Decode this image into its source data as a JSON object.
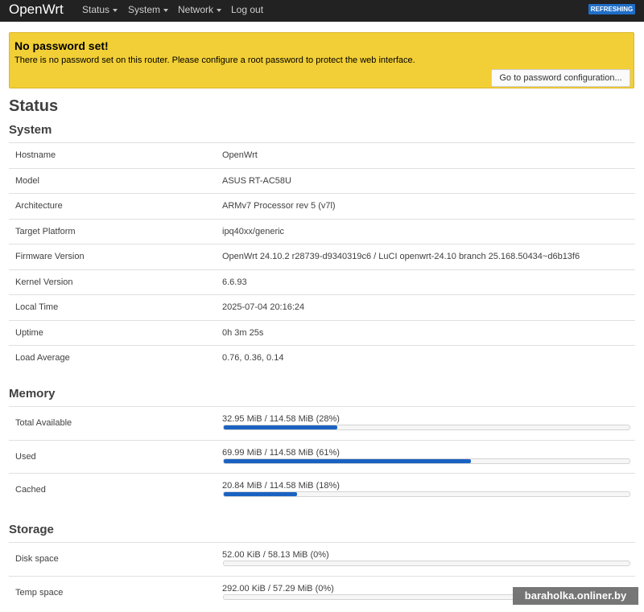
{
  "navbar": {
    "brand": "OpenWrt",
    "items": [
      {
        "label": "Status",
        "dropdown": true
      },
      {
        "label": "System",
        "dropdown": true
      },
      {
        "label": "Network",
        "dropdown": true
      },
      {
        "label": "Log out",
        "dropdown": false
      }
    ],
    "badge": "REFRESHING"
  },
  "alert": {
    "title": "No password set!",
    "text": "There is no password set on this router. Please configure a root password to protect the web interface.",
    "button": "Go to password configuration..."
  },
  "page_title": "Status",
  "system": {
    "title": "System",
    "rows": [
      {
        "label": "Hostname",
        "value": "OpenWrt"
      },
      {
        "label": "Model",
        "value": "ASUS RT-AC58U"
      },
      {
        "label": "Architecture",
        "value": "ARMv7 Processor rev 5 (v7l)"
      },
      {
        "label": "Target Platform",
        "value": "ipq40xx/generic"
      },
      {
        "label": "Firmware Version",
        "value": "OpenWrt 24.10.2 r28739-d9340319c6 / LuCI openwrt-24.10 branch 25.168.50434~d6b13f6"
      },
      {
        "label": "Kernel Version",
        "value": "6.6.93"
      },
      {
        "label": "Local Time",
        "value": "2025-07-04 20:16:24"
      },
      {
        "label": "Uptime",
        "value": "0h 3m 25s"
      },
      {
        "label": "Load Average",
        "value": "0.76, 0.36, 0.14"
      }
    ]
  },
  "memory": {
    "title": "Memory",
    "rows": [
      {
        "label": "Total Available",
        "value": "32.95 MiB / 114.58 MiB (28%)",
        "percent": 28
      },
      {
        "label": "Used",
        "value": "69.99 MiB / 114.58 MiB (61%)",
        "percent": 61
      },
      {
        "label": "Cached",
        "value": "20.84 MiB / 114.58 MiB (18%)",
        "percent": 18
      }
    ]
  },
  "storage": {
    "title": "Storage",
    "rows": [
      {
        "label": "Disk space",
        "value": "52.00 KiB / 58.13 MiB (0%)",
        "percent": 0
      },
      {
        "label": "Temp space",
        "value": "292.00 KiB / 57.29 MiB (0%)",
        "percent": 0
      }
    ]
  },
  "watermark": "baraholka.onliner.by",
  "colors": {
    "navbar": "#222222",
    "alert": "#f2cf36",
    "progress": "#1a62c2",
    "badge": "#1e6ec8"
  }
}
